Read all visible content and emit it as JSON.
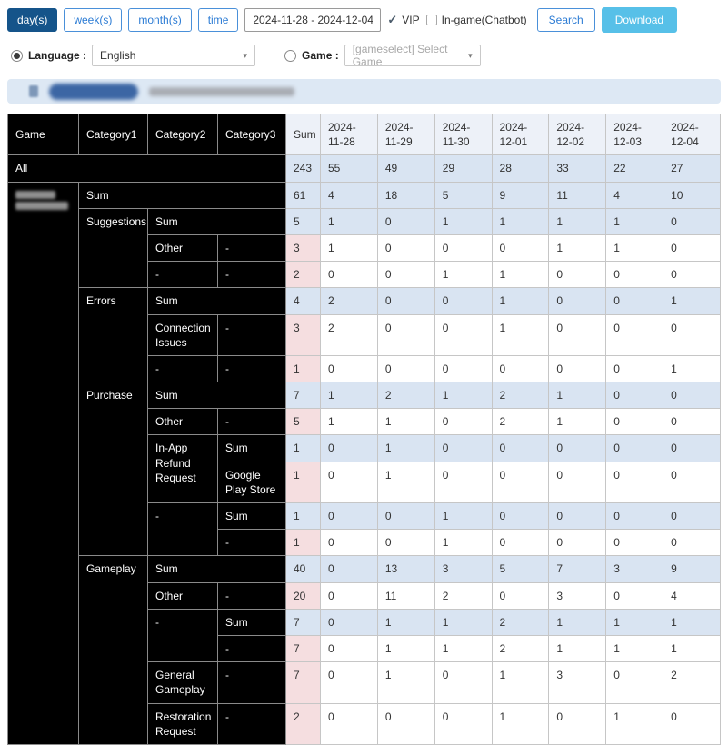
{
  "toolbar": {
    "periods": [
      {
        "label": "day(s)",
        "active": true
      },
      {
        "label": "week(s)",
        "active": false
      },
      {
        "label": "month(s)",
        "active": false
      },
      {
        "label": "time",
        "active": false
      }
    ],
    "date_range": "2024-11-28 - 2024-12-04",
    "vip_label": "VIP",
    "vip_checked": true,
    "ingame_label": "In-game(Chatbot)",
    "ingame_checked": false,
    "search_label": "Search",
    "download_label": "Download"
  },
  "filters": {
    "language_label": "Language :",
    "language_value": "English",
    "language_selected": true,
    "game_label": "Game :",
    "game_value": "[gameselect] Select Game",
    "game_selected": false
  },
  "colors": {
    "active_button_bg": "#15548a",
    "button_border": "#4a90d9",
    "download_bg": "#57c0e8",
    "highlight_row_bg": "#d9e4f2",
    "sum_cell_bg": "#f5dee0",
    "header_light_bg": "#edf1f8",
    "header_dark_bg": "#000000"
  },
  "table": {
    "headers": [
      "Game",
      "Category1",
      "Category2",
      "Category3",
      "Sum",
      "2024-11-28",
      "2024-11-29",
      "2024-11-30",
      "2024-12-01",
      "2024-12-02",
      "2024-12-03",
      "2024-12-04"
    ],
    "rows": [
      {
        "c1": "All",
        "values": [
          243,
          55,
          49,
          29,
          28,
          33,
          22,
          27
        ]
      },
      {
        "c1": "Sum",
        "values": [
          61,
          4,
          18,
          5,
          9,
          11,
          4,
          10
        ]
      },
      {
        "c1": "Suggestions",
        "c2": "Sum",
        "values": [
          5,
          1,
          0,
          1,
          1,
          1,
          1,
          0
        ]
      },
      {
        "c2": "Other",
        "c3": "-",
        "values": [
          3,
          1,
          0,
          0,
          0,
          1,
          1,
          0
        ]
      },
      {
        "c2": "-",
        "c3": "-",
        "values": [
          2,
          0,
          0,
          1,
          1,
          0,
          0,
          0
        ]
      },
      {
        "c1": "Errors",
        "c2": "Sum",
        "values": [
          4,
          2,
          0,
          0,
          1,
          0,
          0,
          1
        ]
      },
      {
        "c2": "Connection Issues",
        "c3": "-",
        "values": [
          3,
          2,
          0,
          0,
          1,
          0,
          0,
          0
        ]
      },
      {
        "c2": "-",
        "c3": "-",
        "values": [
          1,
          0,
          0,
          0,
          0,
          0,
          0,
          1
        ]
      },
      {
        "c1": "Purchase",
        "c2": "Sum",
        "values": [
          7,
          1,
          2,
          1,
          2,
          1,
          0,
          0
        ]
      },
      {
        "c2": "Other",
        "c3": "-",
        "values": [
          5,
          1,
          1,
          0,
          2,
          1,
          0,
          0
        ]
      },
      {
        "c2": "In-App Refund Request",
        "c3": "Sum",
        "values": [
          1,
          0,
          1,
          0,
          0,
          0,
          0,
          0
        ]
      },
      {
        "c3": "Google Play Store",
        "values": [
          1,
          0,
          1,
          0,
          0,
          0,
          0,
          0
        ]
      },
      {
        "c2": "-",
        "c3": "Sum",
        "values": [
          1,
          0,
          0,
          1,
          0,
          0,
          0,
          0
        ]
      },
      {
        "c3": "-",
        "values": [
          1,
          0,
          0,
          1,
          0,
          0,
          0,
          0
        ]
      },
      {
        "c1": "Gameplay",
        "c2": "Sum",
        "values": [
          40,
          0,
          13,
          3,
          5,
          7,
          3,
          9
        ]
      },
      {
        "c2": "Other",
        "c3": "-",
        "values": [
          20,
          0,
          11,
          2,
          0,
          3,
          0,
          4
        ]
      },
      {
        "c2": "-",
        "c3": "Sum",
        "values": [
          7,
          0,
          1,
          1,
          2,
          1,
          1,
          1
        ]
      },
      {
        "c3": "-",
        "values": [
          7,
          0,
          1,
          1,
          2,
          1,
          1,
          1
        ]
      },
      {
        "c2": "General Gameplay",
        "c3": "-",
        "values": [
          7,
          0,
          1,
          0,
          1,
          3,
          0,
          2
        ]
      },
      {
        "c2": "Restoration Request",
        "c3": "-",
        "values": [
          2,
          0,
          0,
          0,
          1,
          0,
          1,
          0
        ]
      }
    ]
  }
}
